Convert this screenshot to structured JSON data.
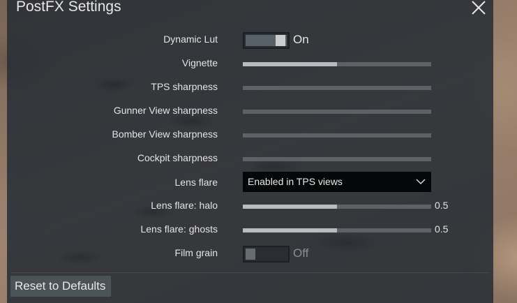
{
  "dialog": {
    "title": "PostFX Settings",
    "close_icon": "close-icon"
  },
  "settings": {
    "dynamic_lut": {
      "label": "Dynamic Lut",
      "state": "On",
      "checked": true
    },
    "vignette": {
      "label": "Vignette",
      "value": 0.5
    },
    "tps_sharpness": {
      "label": "TPS sharpness",
      "value": 0
    },
    "gunner_view_sharpness": {
      "label": "Gunner View sharpness",
      "value": 0
    },
    "bomber_view_sharpness": {
      "label": "Bomber View sharpness",
      "value": 0
    },
    "cockpit_sharpness": {
      "label": "Cockpit sharpness",
      "value": 0
    },
    "lens_flare": {
      "label": "Lens flare",
      "selected": "Enabled in TPS views"
    },
    "lens_flare_halo": {
      "label": "Lens flare: halo",
      "value": 0.5,
      "value_text": "0.5"
    },
    "lens_flare_ghosts": {
      "label": "Lens flare: ghosts",
      "value": 0.5,
      "value_text": "0.5"
    },
    "film_grain": {
      "label": "Film grain",
      "state": "Off",
      "checked": false
    }
  },
  "footer": {
    "reset_label": "Reset to Defaults"
  }
}
